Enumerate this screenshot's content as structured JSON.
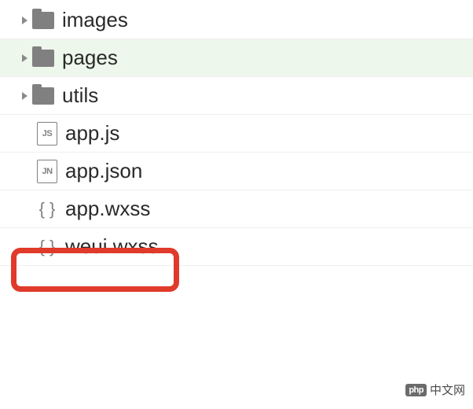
{
  "tree": {
    "items": [
      {
        "type": "folder",
        "label": "images",
        "selected": false
      },
      {
        "type": "folder",
        "label": "pages",
        "selected": true
      },
      {
        "type": "folder",
        "label": "utils",
        "selected": false
      },
      {
        "type": "file",
        "label": "app.js",
        "iconText": "JS"
      },
      {
        "type": "file",
        "label": "app.json",
        "iconText": "JN"
      },
      {
        "type": "file",
        "label": "app.wxss",
        "iconText": "{ }"
      },
      {
        "type": "file",
        "label": "weui.wxss",
        "iconText": "{ }"
      }
    ]
  },
  "highlight": {
    "color": "#e03a2a"
  },
  "watermark": {
    "badge": "php",
    "text": "中文网"
  }
}
